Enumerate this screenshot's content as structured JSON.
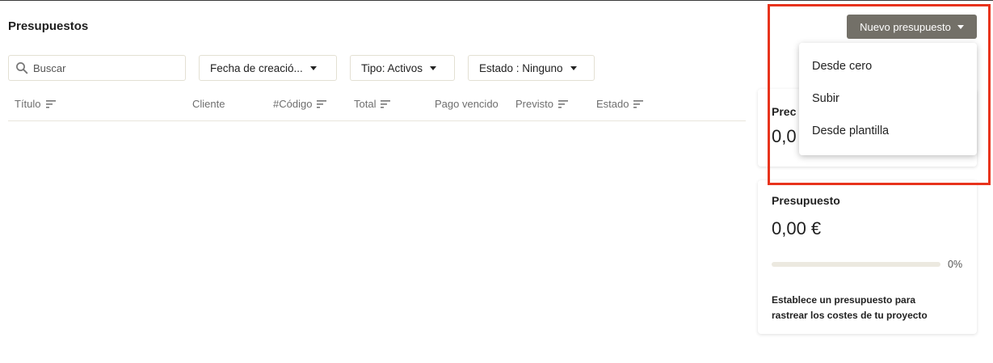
{
  "page": {
    "title": "Presupuestos"
  },
  "search": {
    "placeholder": "Buscar"
  },
  "filters": {
    "date_label": "Fecha de creació...",
    "type_label": "Tipo: Activos",
    "status_label": "Estado : Ninguno"
  },
  "table": {
    "columns": {
      "title": "Título",
      "client": "Cliente",
      "code": "#Código",
      "total": "Total",
      "overdue": "Pago vencido",
      "expected": "Previsto",
      "status": "Estado"
    }
  },
  "new_button": {
    "label": "Nuevo presupuesto"
  },
  "dropdown_menu": {
    "items": [
      "Desde cero",
      "Subir",
      "Desde plantilla"
    ]
  },
  "card_top": {
    "title_partial": "Prec",
    "amount_partial": "0,0"
  },
  "budget_card": {
    "title": "Presupuesto",
    "amount": "0,00 €",
    "progress_percent_label": "0%",
    "progress_value": 0,
    "description": "Establece un presupuesto para rastrear los costes de tu proyecto"
  },
  "colors": {
    "accent_button": "#737068",
    "highlight": "#e8331c",
    "border": "#e3e0d3"
  },
  "icons": {
    "search": "search-icon",
    "sort": "sort-icon",
    "caret": "caret-down-icon"
  }
}
